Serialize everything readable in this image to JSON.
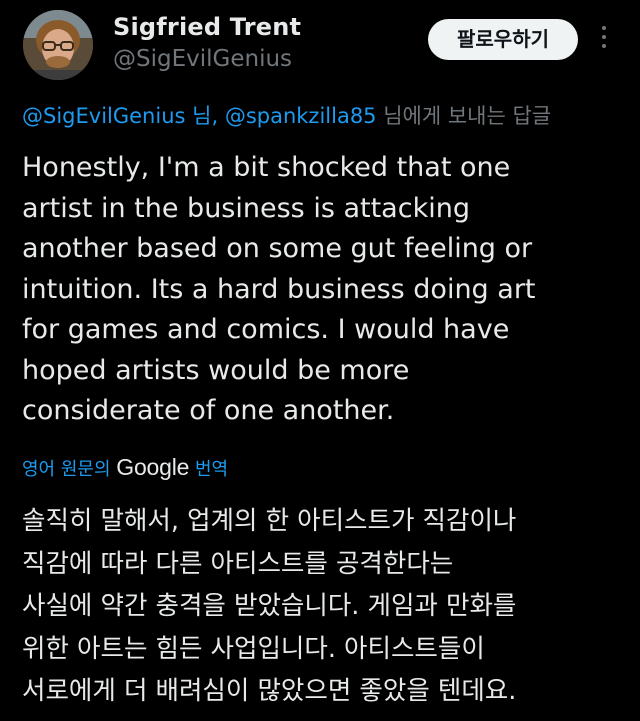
{
  "author": {
    "display_name": "Sigfried Trent",
    "handle": "@SigEvilGenius",
    "avatar_icon": "profile-photo"
  },
  "follow_button": {
    "label": "팔로우하기"
  },
  "more_menu": {
    "icon": "more-vertical-icon"
  },
  "reply_to": {
    "mention_1": "@SigEvilGenius 님",
    "separator": ", ",
    "mention_2": "@spankzilla85",
    "suffix": " 님에게 보내는 답글"
  },
  "tweet": {
    "lines": [
      "Honestly, I'm a bit shocked that one",
      "artist in the business is attacking",
      "another based on some gut feeling or",
      "intuition. Its a hard business doing art",
      "for games and comics. I would have",
      "hoped artists would be more",
      "considerate of one another."
    ]
  },
  "translation": {
    "prefix": "영어 원문의 ",
    "provider": "Google",
    "suffix": " 번역",
    "lines": [
      "솔직히 말해서, 업계의 한 아티스트가 직감이나",
      "직감에 따라 다른 아티스트를 공격한다는",
      "사실에 약간 충격을 받았습니다. 게임과 만화를",
      "위한 아트는 힘든 사업입니다. 아티스트들이",
      "서로에게 더 배려심이 많았으면 좋았을 텐데요."
    ]
  },
  "colors": {
    "background": "#000000",
    "primary_text": "#e7e9ea",
    "secondary_text": "#71767b",
    "link": "#1d9bf0",
    "button_bg": "#eff3f4"
  }
}
